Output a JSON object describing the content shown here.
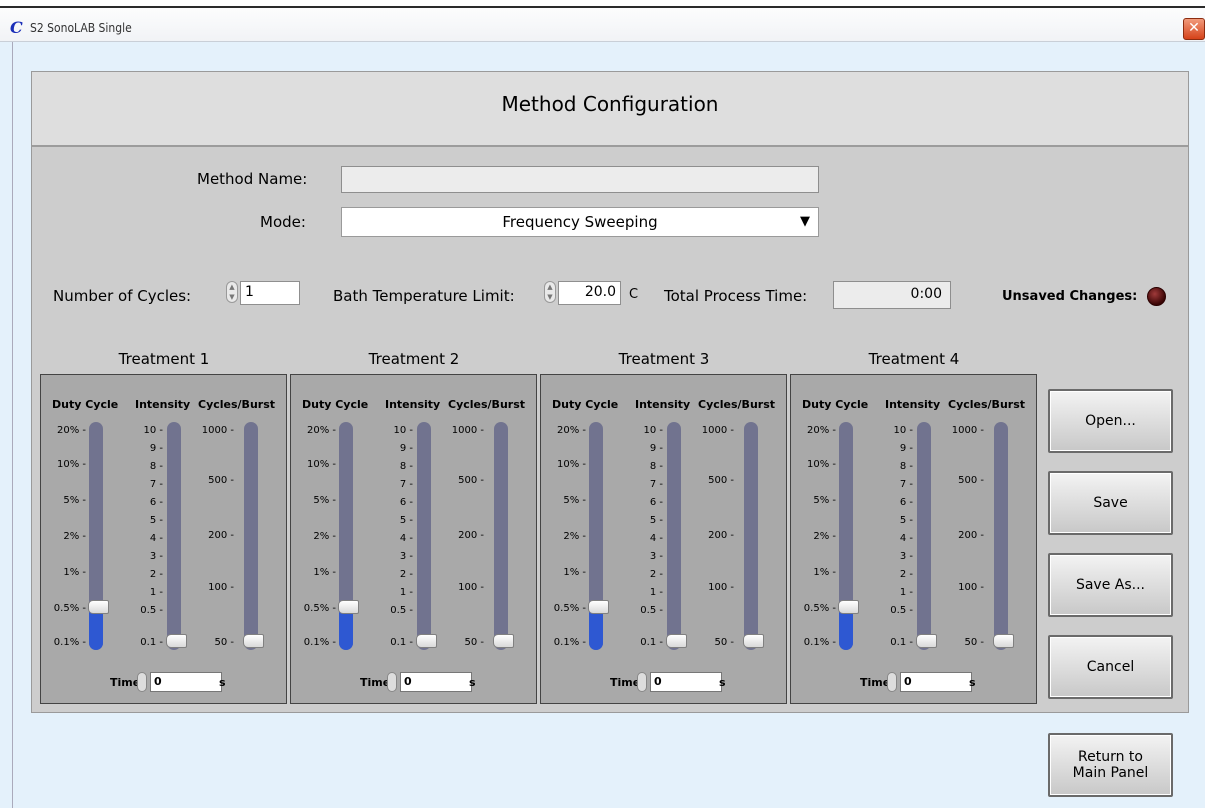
{
  "window": {
    "title": "S2 SonoLAB Single",
    "logo": "C",
    "close": "✕"
  },
  "header": {
    "title": "Method Configuration"
  },
  "form": {
    "method_name_label": "Method Name:",
    "method_name_value": "",
    "mode_label": "Mode:",
    "mode_value": "Frequency Sweeping",
    "cycles_label": "Number of Cycles:",
    "cycles_value": "1",
    "bath_label": "Bath Temperature Limit:",
    "bath_value": "20.0",
    "bath_unit": "C",
    "total_label": "Total Process Time:",
    "total_value": "0:00",
    "unsaved_label": "Unsaved Changes:"
  },
  "treatment_common": {
    "duty_head": "Duty Cycle",
    "intensity_head": "Intensity",
    "cycles_head": "Cycles/Burst",
    "duty_ticks": [
      "20% -",
      "10% -",
      "5% -",
      "2% -",
      "1% -",
      "0.5% -",
      "0.1% -"
    ],
    "intensity_ticks": [
      "10 -",
      "9 -",
      "8 -",
      "7 -",
      "6 -",
      "5 -",
      "4 -",
      "3 -",
      "2 -",
      "1 -",
      "0.5 -",
      "0.1 -"
    ],
    "cycles_ticks": [
      "1000 -",
      "500 -",
      "200 -",
      "100 -",
      "50 -"
    ],
    "time_label": "Time",
    "time_unit": "s"
  },
  "treatments": [
    {
      "title": "Treatment 1",
      "duty": "0.5%",
      "intensity": "0.1",
      "cycles": "50",
      "time": "0"
    },
    {
      "title": "Treatment 2",
      "duty": "0.5%",
      "intensity": "0.1",
      "cycles": "50",
      "time": "0"
    },
    {
      "title": "Treatment 3",
      "duty": "0.5%",
      "intensity": "0.1",
      "cycles": "50",
      "time": "0"
    },
    {
      "title": "Treatment 4",
      "duty": "0.5%",
      "intensity": "0.1",
      "cycles": "50",
      "time": "0"
    }
  ],
  "buttons": {
    "open": "Open...",
    "save": "Save",
    "save_as": "Save As...",
    "cancel": "Cancel",
    "return": "Return to Main Panel"
  },
  "icons": {
    "spin": "spinner-icon",
    "dropdown": "triangle-down-icon",
    "led": "led-indicator-icon"
  },
  "colors": {
    "slider_fill": "#2e58d2",
    "slider_track": "#71738f",
    "led": "#5a0a0a",
    "close": "#d5421a"
  }
}
